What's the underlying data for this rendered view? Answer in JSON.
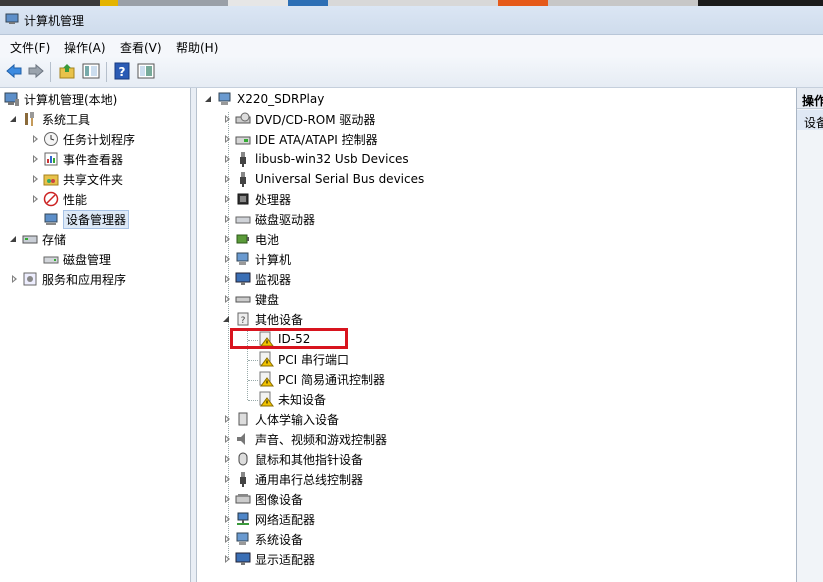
{
  "window": {
    "title": "计算机管理"
  },
  "menu": [
    "文件(F)",
    "操作(A)",
    "查看(V)",
    "帮助(H)"
  ],
  "toolbar": {
    "buttons": [
      "back-icon",
      "forward-icon",
      "up-folder-icon",
      "show-hide-tree-icon",
      "help-icon",
      "properties-icon"
    ]
  },
  "left_tree": {
    "root": "计算机管理(本地)",
    "system_tools": "系统工具",
    "task_scheduler": "任务计划程序",
    "event_viewer": "事件查看器",
    "shared_folders": "共享文件夹",
    "performance": "性能",
    "device_manager": "设备管理器",
    "storage": "存储",
    "disk_management": "磁盘管理",
    "services_apps": "服务和应用程序"
  },
  "device_tree": {
    "computer": "X220_SDRPlay",
    "categories": [
      "DVD/CD-ROM 驱动器",
      "IDE ATA/ATAPI 控制器",
      "libusb-win32 Usb Devices",
      "Universal Serial Bus devices",
      "处理器",
      "磁盘驱动器",
      "电池",
      "计算机",
      "监视器",
      "键盘",
      "其他设备"
    ],
    "other_devices": [
      "ID-52",
      "PCI 串行端口",
      "PCI 简易通讯控制器",
      "未知设备"
    ],
    "categories_after": [
      "人体学输入设备",
      "声音、视频和游戏控制器",
      "鼠标和其他指针设备",
      "通用串行总线控制器",
      "图像设备",
      "网络适配器",
      "系统设备",
      "显示适配器"
    ]
  },
  "actions_panel": {
    "header": "操作",
    "item": "设备"
  },
  "colors": {
    "highlight_box": "#d8141e",
    "selection": "#dde9f7",
    "titlebar": "#dbe6f4"
  }
}
